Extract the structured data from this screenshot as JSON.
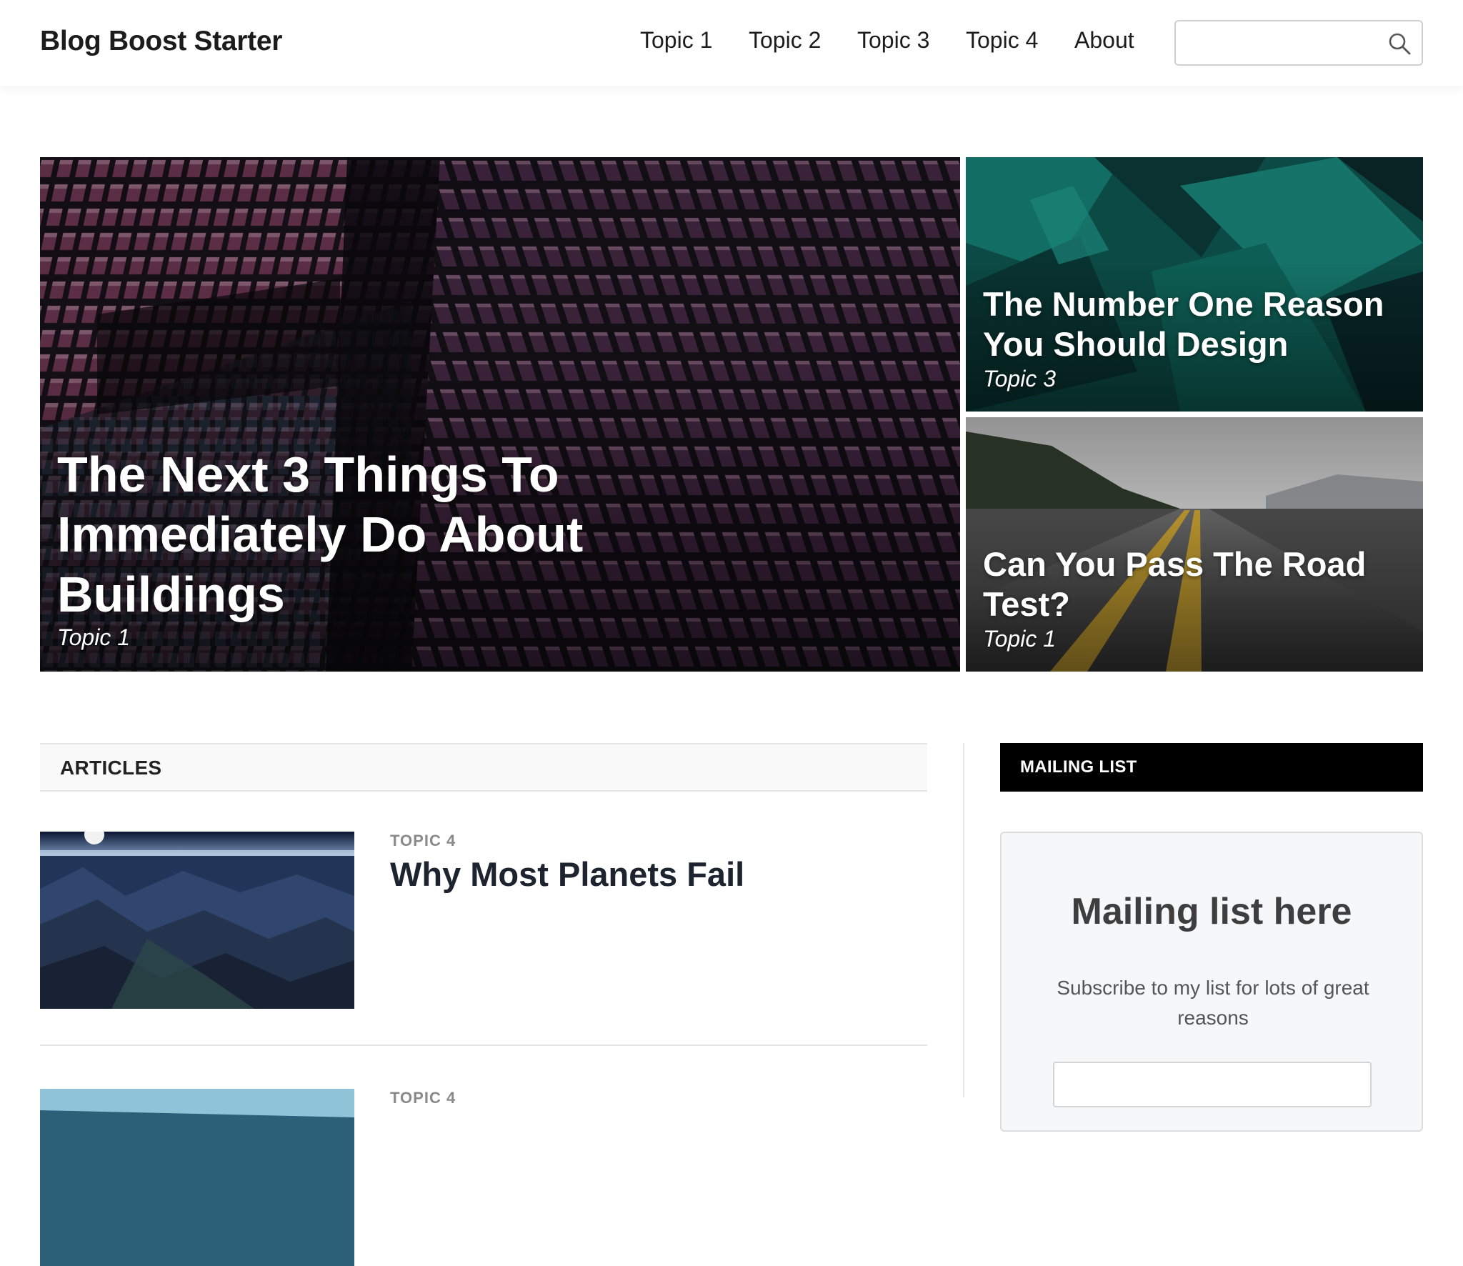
{
  "brand": {
    "title": "Blog Boost Starter"
  },
  "nav": {
    "items": [
      {
        "label": "Topic 1"
      },
      {
        "label": "Topic 2"
      },
      {
        "label": "Topic 3"
      },
      {
        "label": "Topic 4"
      },
      {
        "label": "About"
      }
    ]
  },
  "search": {
    "placeholder": "",
    "icon": "search-icon"
  },
  "hero": {
    "main": {
      "title": "The Next 3 Things To Immediately Do About Buildings",
      "category": "Topic 1"
    },
    "top_right": {
      "title": "The Number One Reason You Should Design",
      "category": "Topic 3"
    },
    "bottom_right": {
      "title": "Can You Pass The Road Test?",
      "category": "Topic 1"
    }
  },
  "articles": {
    "heading": "ARTICLES",
    "items": [
      {
        "category": "TOPIC 4",
        "title": "Why Most Planets Fail"
      },
      {
        "category": "TOPIC 4",
        "title": ""
      }
    ]
  },
  "sidebar": {
    "mailing": {
      "heading": "MAILING LIST",
      "title": "Mailing list here",
      "text": "Subscribe to my list for lots of great reasons",
      "input_placeholder": ""
    }
  },
  "colors": {
    "header_bg": "#ffffff",
    "mailing_head_bg": "#000000",
    "article_title": "#1d2430",
    "category_gray": "#8a8a8a"
  }
}
